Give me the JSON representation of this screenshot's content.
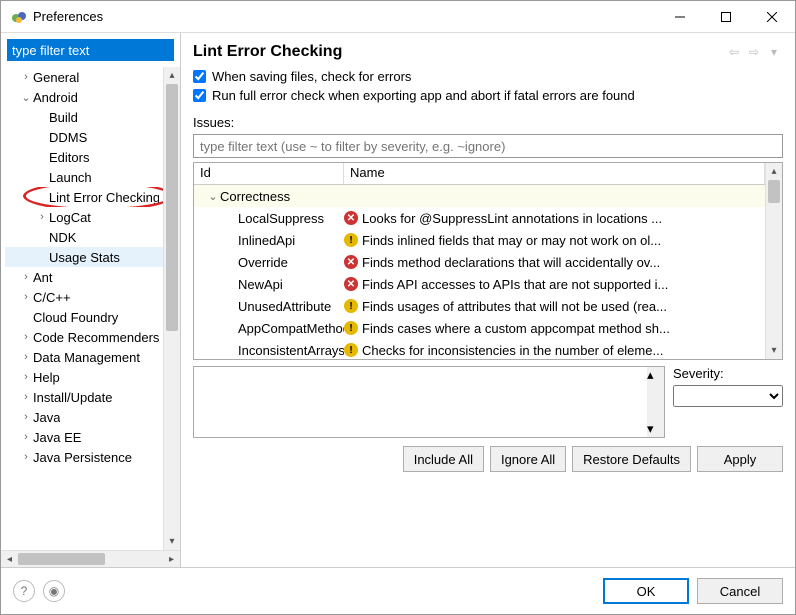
{
  "window": {
    "title": "Preferences"
  },
  "sidebar": {
    "filter_value": "type filter text",
    "items": [
      {
        "label": "General",
        "tw": "›",
        "indent": 1
      },
      {
        "label": "Android",
        "tw": "⌄",
        "indent": 1
      },
      {
        "label": "Build",
        "tw": "",
        "indent": 2
      },
      {
        "label": "DDMS",
        "tw": "",
        "indent": 2
      },
      {
        "label": "Editors",
        "tw": "",
        "indent": 2
      },
      {
        "label": "Launch",
        "tw": "",
        "indent": 2
      },
      {
        "label": "Lint Error Checking",
        "tw": "",
        "indent": 2,
        "highlighted": true
      },
      {
        "label": "LogCat",
        "tw": "›",
        "indent": 2
      },
      {
        "label": "NDK",
        "tw": "",
        "indent": 2
      },
      {
        "label": "Usage Stats",
        "tw": "",
        "indent": 2,
        "selected": true
      },
      {
        "label": "Ant",
        "tw": "›",
        "indent": 1
      },
      {
        "label": "C/C++",
        "tw": "›",
        "indent": 1
      },
      {
        "label": "Cloud Foundry",
        "tw": "",
        "indent": 1
      },
      {
        "label": "Code Recommenders",
        "tw": "›",
        "indent": 1
      },
      {
        "label": "Data Management",
        "tw": "›",
        "indent": 1
      },
      {
        "label": "Help",
        "tw": "›",
        "indent": 1
      },
      {
        "label": "Install/Update",
        "tw": "›",
        "indent": 1
      },
      {
        "label": "Java",
        "tw": "›",
        "indent": 1
      },
      {
        "label": "Java EE",
        "tw": "›",
        "indent": 1
      },
      {
        "label": "Java Persistence",
        "tw": "›",
        "indent": 1
      }
    ]
  },
  "main": {
    "title": "Lint Error Checking",
    "check1": "When saving files, check for errors",
    "check2": "Run full error check when exporting app and abort if fatal errors are found",
    "issues_label": "Issues:",
    "filter_placeholder": "type filter text (use ~ to filter by severity, e.g. ~ignore)",
    "columns": {
      "id": "Id",
      "name": "Name"
    },
    "category": "Correctness",
    "rows": [
      {
        "id": "LocalSuppress",
        "sev": "err",
        "name": "Looks for @SuppressLint annotations in locations ..."
      },
      {
        "id": "InlinedApi",
        "sev": "warn",
        "name": "Finds inlined fields that may or may not work on ol..."
      },
      {
        "id": "Override",
        "sev": "err",
        "name": "Finds method declarations that will accidentally ov..."
      },
      {
        "id": "NewApi",
        "sev": "err",
        "name": "Finds API accesses to APIs that are not supported i..."
      },
      {
        "id": "UnusedAttribute",
        "sev": "warn",
        "name": "Finds usages of attributes that will not be used (rea..."
      },
      {
        "id": "AppCompatMethod",
        "sev": "warn",
        "name": "Finds cases where a custom appcompat method sh..."
      },
      {
        "id": "InconsistentArrays",
        "sev": "warn",
        "name": "Checks for inconsistencies in the number of eleme..."
      }
    ],
    "severity_label": "Severity:",
    "buttons": {
      "include_all": "Include All",
      "ignore_all": "Ignore All",
      "restore": "Restore Defaults",
      "apply": "Apply"
    }
  },
  "footer": {
    "ok": "OK",
    "cancel": "Cancel"
  }
}
